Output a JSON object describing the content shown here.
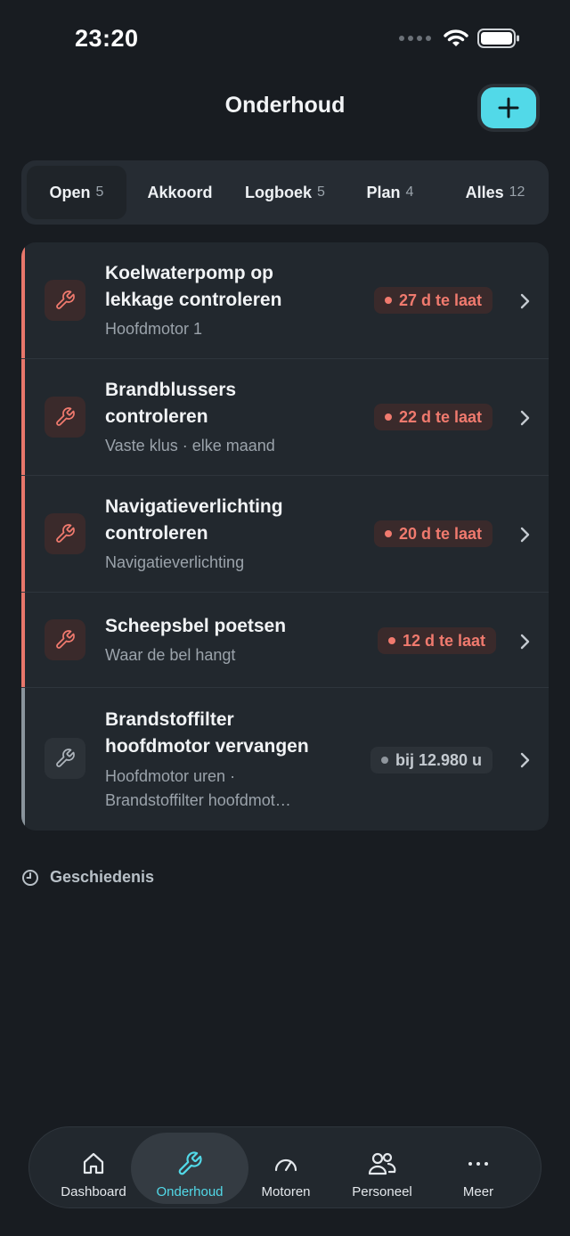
{
  "status_bar": {
    "time": "23:20"
  },
  "header": {
    "title": "Onderhoud"
  },
  "tabs": [
    {
      "label": "Open",
      "count": "5",
      "active": true
    },
    {
      "label": "Akkoord",
      "count": "",
      "active": false
    },
    {
      "label": "Logboek",
      "count": "5",
      "active": false
    },
    {
      "label": "Plan",
      "count": "4",
      "active": false
    },
    {
      "label": "Alles",
      "count": "12",
      "active": false
    }
  ],
  "tasks": [
    {
      "title_line1": "Koelwaterpomp op",
      "title_line2": "lekkage controleren",
      "sub_line1": "Hoofdmotor 1",
      "sub_line2": "",
      "badge": "27 d te laat",
      "status": "overdue"
    },
    {
      "title_line1": "Brandblussers",
      "title_line2": "controleren",
      "sub_line1": "Vaste klus · elke maand",
      "sub_line2": "",
      "badge": "22 d te laat",
      "status": "overdue"
    },
    {
      "title_line1": "Navigatieverlichting",
      "title_line2": "controleren",
      "sub_line1": "Navigatieverlichting",
      "sub_line2": "",
      "badge": "20 d te laat",
      "status": "overdue"
    },
    {
      "title_line1": "Scheepsbel poetsen",
      "title_line2": "",
      "sub_line1": "Waar de bel hangt",
      "sub_line2": "",
      "badge": "12 d te laat",
      "status": "overdue"
    },
    {
      "title_line1": "Brandstoffilter",
      "title_line2": "hoofdmotor vervangen",
      "sub_line1": "Hoofdmotor uren ·",
      "sub_line2": "Brandstoffilter hoofdmot…",
      "badge": "bij 12.980 u",
      "status": "hours"
    }
  ],
  "history": {
    "label": "Geschiedenis"
  },
  "nav": [
    {
      "label": "Dashboard",
      "icon": "home-icon",
      "active": false
    },
    {
      "label": "Onderhoud",
      "icon": "wrench-icon",
      "active": true
    },
    {
      "label": "Motoren",
      "icon": "gauge-icon",
      "active": false
    },
    {
      "label": "Personeel",
      "icon": "people-icon",
      "active": false
    },
    {
      "label": "Meer",
      "icon": "more-icon",
      "active": false
    }
  ],
  "colors": {
    "accent": "#52d9e8",
    "overdue": "#f07a6e",
    "background": "#181c21",
    "card": "#22282e"
  }
}
